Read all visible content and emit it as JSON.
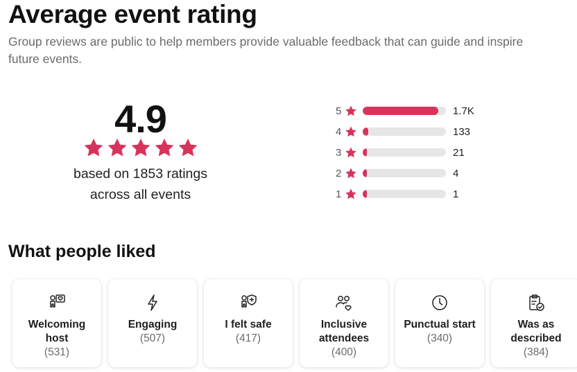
{
  "header": {
    "title": "Average event rating",
    "subtitle": "Group reviews are public to help members provide valuable feedback that can guide and inspire future events."
  },
  "summary": {
    "rating": "4.9",
    "stars_filled": 5,
    "based_line1": "based on 1853 ratings",
    "based_line2": "across all events"
  },
  "breakdown": [
    {
      "stars": "5",
      "count": "1.7K",
      "fraction": 0.91
    },
    {
      "stars": "4",
      "count": "133",
      "fraction": 0.07
    },
    {
      "stars": "3",
      "count": "21",
      "fraction": 0.012
    },
    {
      "stars": "2",
      "count": "4",
      "fraction": 0.004
    },
    {
      "stars": "1",
      "count": "1",
      "fraction": 0.002
    }
  ],
  "liked": {
    "title": "What people liked",
    "cards": [
      {
        "icon": "welcoming-host-icon",
        "label": "Welcoming host",
        "count": "(531)"
      },
      {
        "icon": "lightning-icon",
        "label": "Engaging",
        "count": "(507)"
      },
      {
        "icon": "person-shield-icon",
        "label": "I felt safe",
        "count": "(417)"
      },
      {
        "icon": "people-heart-icon",
        "label": "Inclusive attendees",
        "count": "(400)"
      },
      {
        "icon": "clock-icon",
        "label": "Punctual start",
        "count": "(340)"
      },
      {
        "icon": "clipboard-check-icon",
        "label": "Was as described",
        "count": "(384)"
      }
    ]
  },
  "colors": {
    "accent": "#d6345c",
    "bar_track": "#e6e6e6"
  }
}
